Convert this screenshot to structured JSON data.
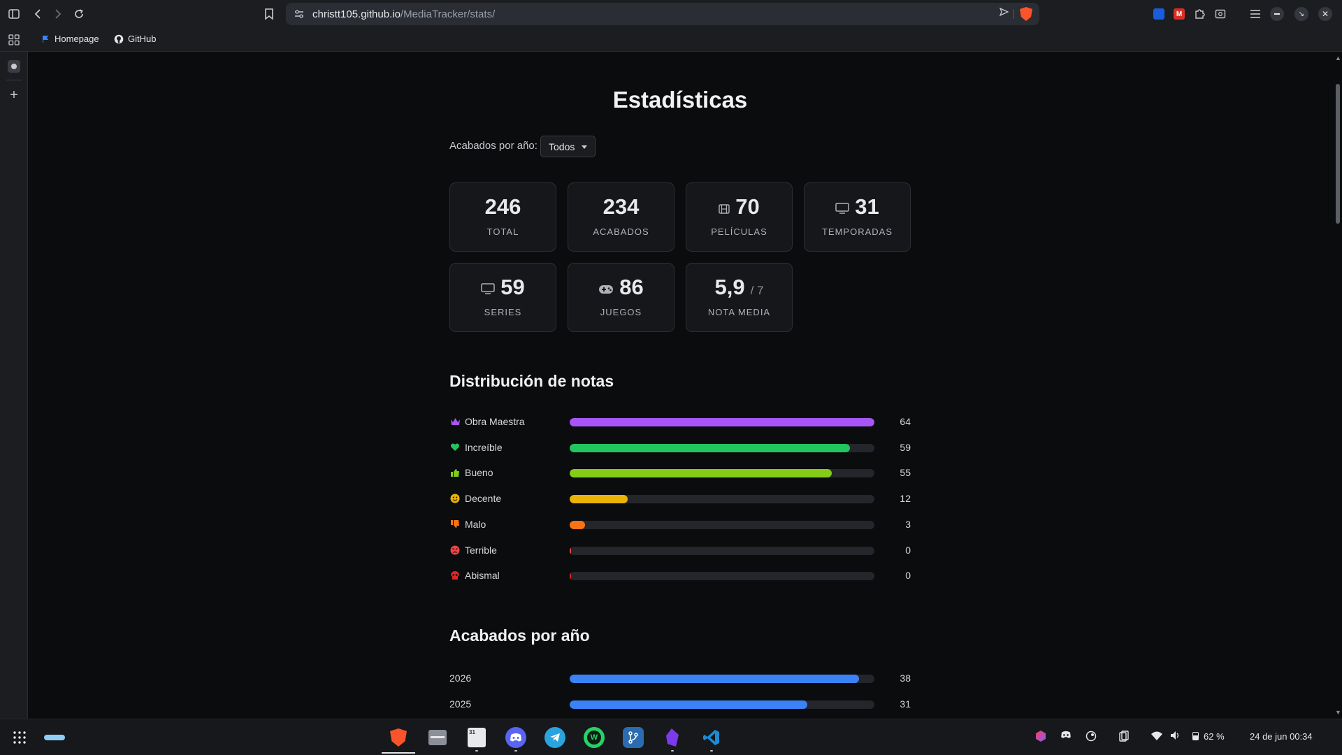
{
  "browser": {
    "url_host": "christt105.github.io",
    "url_path": "/MediaTracker/stats/",
    "bookmarks": [
      {
        "label": "Homepage",
        "icon": "bookmark-flag-icon"
      },
      {
        "label": "GitHub",
        "icon": "github-icon"
      }
    ]
  },
  "page": {
    "title": "Estadísticas",
    "filter": {
      "label": "Acabados por año:",
      "value": "Todos"
    },
    "cards": [
      {
        "value": "246",
        "label": "TOTAL",
        "icon": ""
      },
      {
        "value": "234",
        "label": "ACABADOS",
        "icon": ""
      },
      {
        "value": "70",
        "label": "PELÍCULAS",
        "icon": "film-icon"
      },
      {
        "value": "31",
        "label": "TEMPORADAS",
        "icon": "tv-icon"
      },
      {
        "value": "59",
        "label": "SERIES",
        "icon": "tv-icon"
      },
      {
        "value": "86",
        "label": "JUEGOS",
        "icon": "gamepad-icon"
      },
      {
        "value": "5,9",
        "suffix": "/ 7",
        "label": "NOTA MEDIA",
        "icon": ""
      }
    ],
    "distribution": {
      "title": "Distribución de notas",
      "rows": [
        {
          "label": "Obra Maestra",
          "value": "64",
          "fraction": 1.0,
          "color": "#a855f7",
          "icon": "crown-icon",
          "icon_color": "#a855f7"
        },
        {
          "label": "Increíble",
          "value": "59",
          "fraction": 0.92,
          "color": "#22c55e",
          "icon": "heart-icon",
          "icon_color": "#22c55e"
        },
        {
          "label": "Bueno",
          "value": "55",
          "fraction": 0.86,
          "color": "#84cc16",
          "icon": "thumbs-up-icon",
          "icon_color": "#84cc16"
        },
        {
          "label": "Decente",
          "value": "12",
          "fraction": 0.19,
          "color": "#eab308",
          "icon": "smile-icon",
          "icon_color": "#eab308"
        },
        {
          "label": "Malo",
          "value": "3",
          "fraction": 0.05,
          "color": "#f97316",
          "icon": "thumbs-down-icon",
          "icon_color": "#f97316"
        },
        {
          "label": "Terrible",
          "value": "0",
          "fraction": 0.0,
          "color": "#ef4444",
          "icon": "angry-face-icon",
          "icon_color": "#ef4444"
        },
        {
          "label": "Abismal",
          "value": "0",
          "fraction": 0.0,
          "color": "#dc2626",
          "icon": "skull-icon",
          "icon_color": "#dc2626"
        }
      ]
    },
    "by_year": {
      "title": "Acabados por año",
      "rows": [
        {
          "label": "2026",
          "value": "38",
          "fraction": 0.95,
          "color": "#3b82f6"
        },
        {
          "label": "2025",
          "value": "31",
          "fraction": 0.78,
          "color": "#3b82f6"
        }
      ]
    }
  },
  "taskbar": {
    "apps": [
      "brave-icon",
      "files-icon",
      "calendar-icon",
      "discord-icon",
      "telegram-icon",
      "whatsapp-icon",
      "git-icon",
      "obsidian-icon",
      "vscode-icon"
    ],
    "calendar_day": "31",
    "battery": "62 %",
    "datetime": "24 de jun  00:34"
  }
}
